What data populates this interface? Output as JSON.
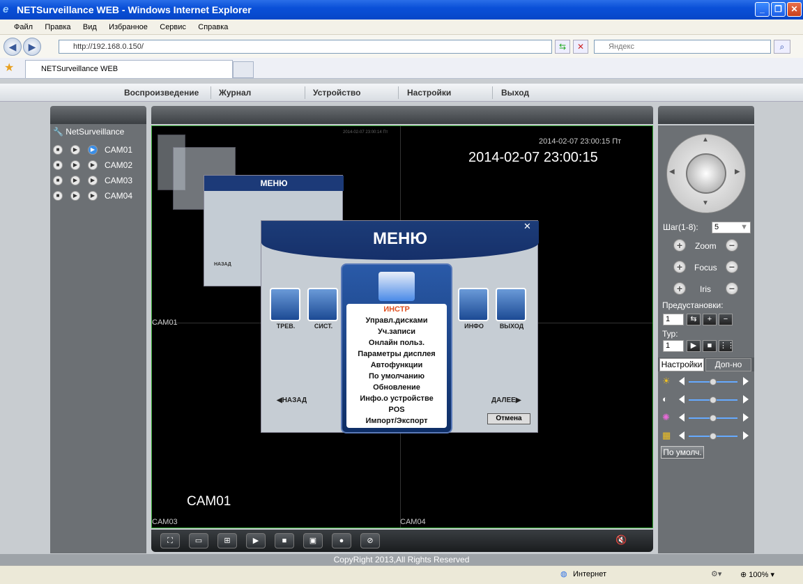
{
  "window": {
    "title": "NETSurveillance WEB - Windows Internet Explorer",
    "min": "_",
    "max": "❐",
    "close": "✕"
  },
  "menubar": [
    "Файл",
    "Правка",
    "Вид",
    "Избранное",
    "Сервис",
    "Справка"
  ],
  "address": {
    "url": "http://192.168.0.150/",
    "search_placeholder": "Яндекс"
  },
  "tab": {
    "title": "NETSurveillance WEB"
  },
  "nav": [
    "Воспроизведение",
    "Журнал",
    "Устройство",
    "Настройки",
    "Выход"
  ],
  "tree": {
    "root": "NetSurveillance",
    "cams": [
      "CAM01",
      "CAM02",
      "CAM03",
      "CAM04"
    ]
  },
  "video": {
    "osd_small_time": "2014-02-07 23:00:15 Пт",
    "osd_big_time": "2014-02-07 23:00:15",
    "tiny_time": "2014-02-07 23:00:14 Пт",
    "cam_label": "CAM01",
    "q1": "CAM01",
    "q3": "CAM03",
    "q4": "CAM04",
    "menu": {
      "title": "МЕНЮ",
      "selected": "ИНСТР",
      "items": [
        "Управл.дисками",
        "Уч.записи",
        "Онлайн польз.",
        "Параметры дисплея",
        "Автофункции",
        "По умолчанию",
        "Обновление",
        "Инфо.о устройстве",
        "POS",
        "Импорт/Экспорт"
      ],
      "left_icons": [
        "ТРЕВ.",
        "СИСТ."
      ],
      "right_icons": [
        "ИНФО",
        "ВЫХОД"
      ],
      "back": "НАЗАД",
      "next": "ДАЛЕЕ",
      "cancel": "Отмена"
    },
    "mid_menu_title": "МЕНЮ",
    "mid_back": "НАЗАД"
  },
  "ptz": {
    "step_label": "Шаг(1-8):",
    "step_value": "5",
    "zoom": "Zoom",
    "focus": "Focus",
    "iris": "Iris",
    "presets_label": "Предустановки:",
    "preset_value": "1",
    "tour_label": "Тур:",
    "tour_value": "1"
  },
  "settings": {
    "tabs": [
      "Настройки",
      "Доп-но"
    ],
    "sliders": [
      {
        "name": "brightness",
        "level": 0.5
      },
      {
        "name": "contrast",
        "level": 0.5
      },
      {
        "name": "saturation",
        "level": 0.5
      },
      {
        "name": "hue",
        "level": 0.5
      }
    ],
    "default_button": "По умолч."
  },
  "footer": "CopyRight 2013,All Rights Reserved",
  "status": {
    "zone": "Интернет",
    "zoom": "100%"
  }
}
